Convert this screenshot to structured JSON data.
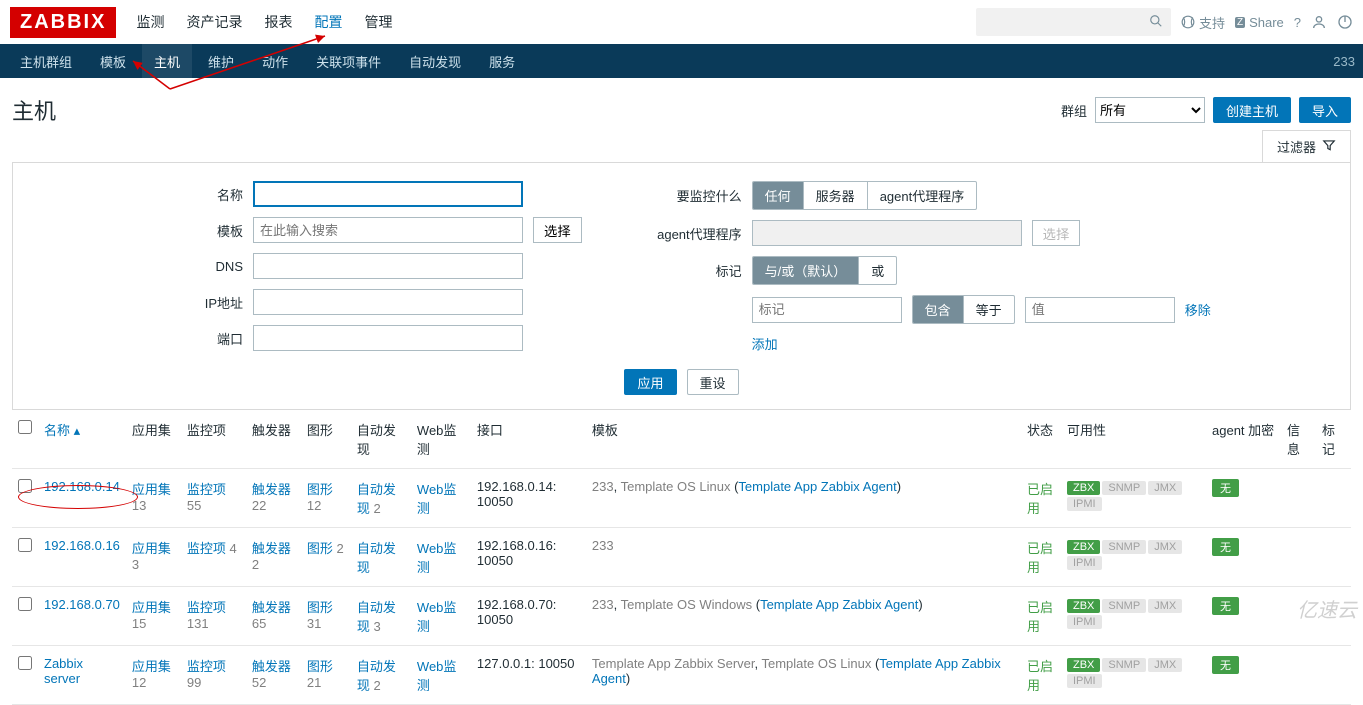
{
  "logo": "ZABBIX",
  "topnav": [
    "监测",
    "资产记录",
    "报表",
    "配置",
    "管理"
  ],
  "topnav_active": 3,
  "top_right": {
    "support": "支持",
    "share": "Share"
  },
  "subnav": [
    "主机群组",
    "模板",
    "主机",
    "维护",
    "动作",
    "关联项事件",
    "自动发现",
    "服务"
  ],
  "subnav_active": 2,
  "sub_count": "233",
  "page_title": "主机",
  "head": {
    "group_lbl": "群组",
    "group_val": "所有",
    "create": "创建主机",
    "import": "导入"
  },
  "filter_tab": "过滤器",
  "filter": {
    "name_lbl": "名称",
    "template_lbl": "模板",
    "template_ph": "在此输入搜索",
    "select": "选择",
    "dns_lbl": "DNS",
    "ip_lbl": "IP地址",
    "port_lbl": "端口",
    "monitor_lbl": "要监控什么",
    "monitor_opts": [
      "任何",
      "服务器",
      "agent代理程序"
    ],
    "proxy_lbl": "agent代理程序",
    "proxy_select": "选择",
    "tags_lbl": "标记",
    "tags_and": "与/或（默认）",
    "tags_or": "或",
    "tag_ph": "标记",
    "contains": "包含",
    "equals": "等于",
    "value_ph": "值",
    "remove": "移除",
    "add": "添加",
    "apply": "应用",
    "reset": "重设"
  },
  "headers": [
    "名称",
    "应用集",
    "监控项",
    "触发器",
    "图形",
    "自动发现",
    "Web监测",
    "接口",
    "模板",
    "状态",
    "可用性",
    "agent 加密",
    "信息",
    "标记"
  ],
  "av": {
    "zbx": "ZBX",
    "snmp": "SNMP",
    "jmx": "JMX",
    "ipmi": "IPMI"
  },
  "enc": "无",
  "rows": [
    {
      "name": "192.168.0.14",
      "app": "应用集",
      "app_n": "13",
      "item": "监控项",
      "item_n": "55",
      "trig": "触发器",
      "trig_n": "22",
      "graph": "图形",
      "graph_n": "12",
      "disc": "自动发现",
      "disc_n": "2",
      "web": "Web监测",
      "iface": "192.168.0.14: 10050",
      "tmpl_a": "233",
      "tmpl_b": "Template OS Linux",
      "tmpl_c": "Template App Zabbix Agent",
      "status": "已启用"
    },
    {
      "name": "192.168.0.16",
      "app": "应用集",
      "app_n": "3",
      "item": "监控项",
      "item_n": "4",
      "trig": "触发器",
      "trig_n": "2",
      "graph": "图形",
      "graph_n": "2",
      "disc": "自动发现",
      "disc_n": "",
      "web": "Web监测",
      "iface": "192.168.0.16: 10050",
      "tmpl_a": "233",
      "tmpl_b": "",
      "tmpl_c": "",
      "status": "已启用"
    },
    {
      "name": "192.168.0.70",
      "app": "应用集",
      "app_n": "15",
      "item": "监控项",
      "item_n": "131",
      "trig": "触发器",
      "trig_n": "65",
      "graph": "图形",
      "graph_n": "31",
      "disc": "自动发现",
      "disc_n": "3",
      "web": "Web监测",
      "iface": "192.168.0.70: 10050",
      "tmpl_a": "233",
      "tmpl_b": "Template OS Windows",
      "tmpl_c": "Template App Zabbix Agent",
      "status": "已启用"
    },
    {
      "name": "Zabbix server",
      "app": "应用集",
      "app_n": "12",
      "item": "监控项",
      "item_n": "99",
      "trig": "触发器",
      "trig_n": "52",
      "graph": "图形",
      "graph_n": "21",
      "disc": "自动发现",
      "disc_n": "2",
      "web": "Web监测",
      "iface": "127.0.0.1: 10050",
      "tmpl_a": "Template App Zabbix Server",
      "tmpl_b": "Template OS Linux",
      "tmpl_c": "Template App Zabbix Agent",
      "status": "已启用"
    }
  ],
  "watermark": "亿速云"
}
